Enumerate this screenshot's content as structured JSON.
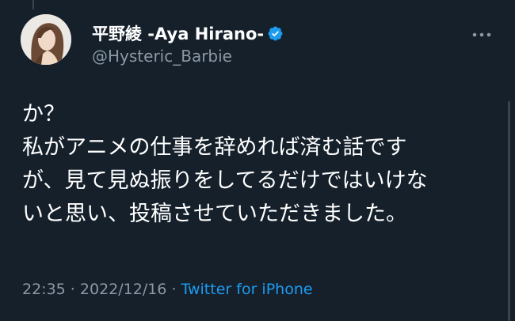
{
  "tweet": {
    "display_name": "平野綾 -Aya Hirano-",
    "handle": "@Hysteric_Barbie",
    "lines": [
      "か？",
      "私がアニメの仕事を辞めれば済む話です",
      "が、見て見ぬ振りをしてるだけではいけな",
      "いと思い、投稿させていただきました。"
    ],
    "time": "22:35",
    "separator": " · ",
    "date": "2022/12/16",
    "source": "Twitter for iPhone"
  },
  "icons": {
    "verified": "verified-badge-icon",
    "more": "more-options-icon"
  },
  "colors": {
    "background": "#15202b",
    "text": "#ffffff",
    "secondary": "#8b98a5",
    "accent": "#1d9bf0"
  }
}
